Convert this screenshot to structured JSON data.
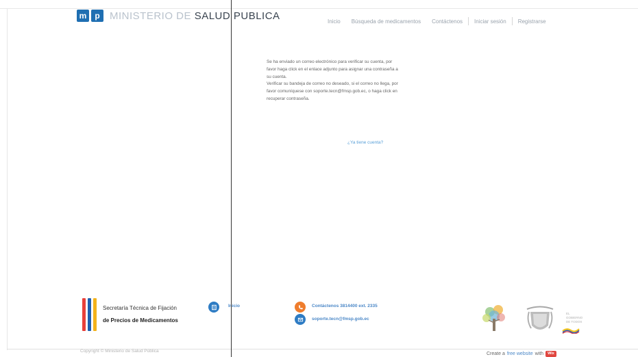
{
  "header": {
    "logo_initials": [
      "m",
      "p"
    ],
    "logo_text_light": "MINISTERIO DE ",
    "logo_text_dark": "SALUD PUBLICA",
    "nav": [
      "Inicio",
      "Búsqueda de medicamentos",
      "Contáctenos",
      "Iniciar sesión",
      "Registrarse"
    ]
  },
  "main": {
    "message_p1": "Se ha enviado un correo electrónico para verificar su cuenta, por favor haga click en el enlace adjunto para asignar una contraseña a su cuenta.",
    "message_p2": "Verificar su bandeja de correo no deseado, si el correo no llega, por favor comuníquese con soporte.tecn@fmsp.gob.ec, o haga click en recuperar contraseña.",
    "account_link": "¿Ya tiene cuenta?"
  },
  "footer": {
    "brand_line1": "Secretaría Técnica de Fijación",
    "brand_line2": "de Precios de Medicamentos",
    "brand_bar_colors": [
      "#e8403a",
      "#1f5fb0",
      "#f3b21b"
    ],
    "home_link": "Inicio",
    "phone": "Contáctenos 3814400 ext. 2335",
    "email": "soporte.tecn@fmsp.gob.ec",
    "gov_logo_text": [
      "EL",
      "GOBIERNO",
      "DE TODOS"
    ],
    "copyright": "Copyright © Ministerio de Salud Pública",
    "create_prefix": "Create a",
    "create_link": "free website",
    "create_with": "with",
    "create_badge": "Wix"
  },
  "colors": {
    "accent_blue": "#1f6fb2",
    "link_blue": "#4a87c7",
    "phone_orange": "#ef7d2d"
  },
  "icons": {
    "home": "home-icon",
    "phone": "phone-icon",
    "email": "email-icon"
  }
}
